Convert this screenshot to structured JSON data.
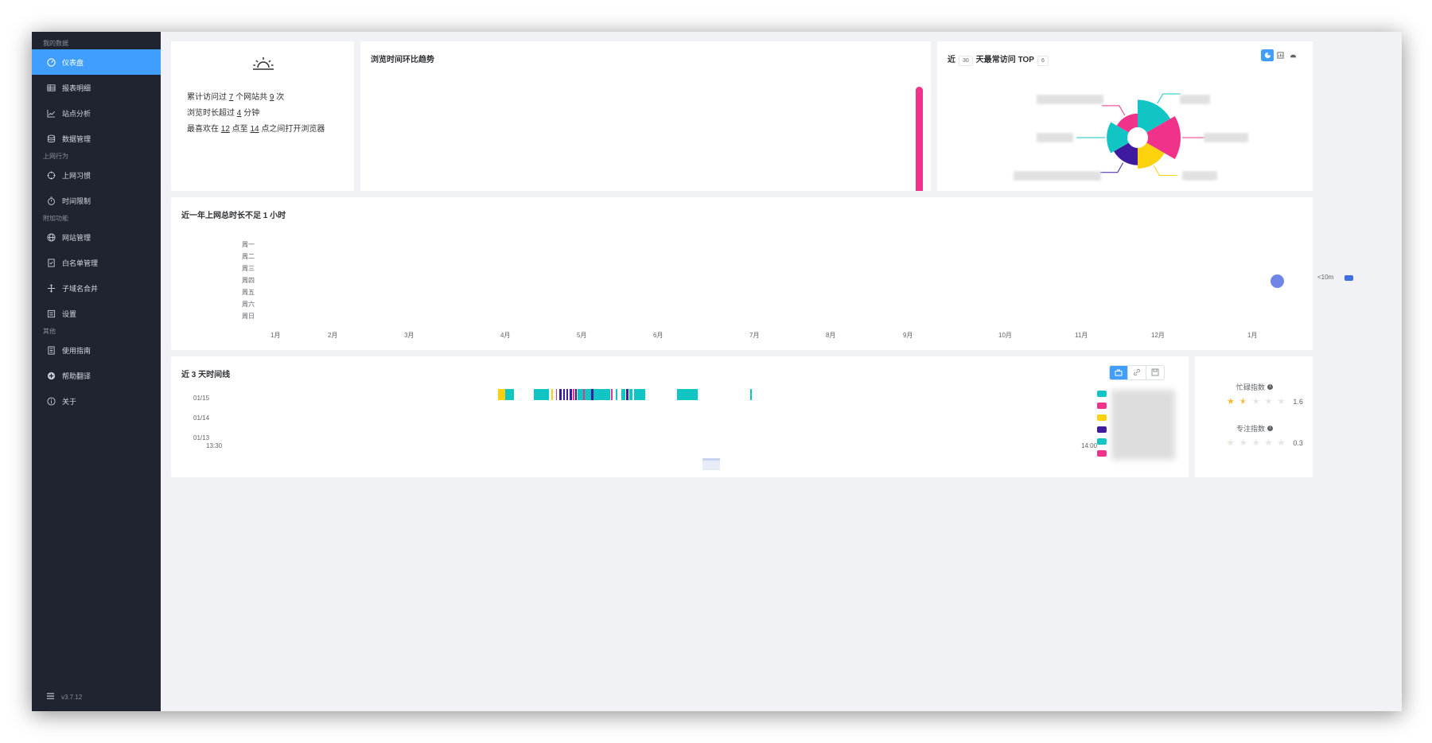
{
  "sidebar": {
    "groups": [
      {
        "title": "我的数据",
        "items": [
          {
            "label": "仪表盘",
            "icon": "dashboard-icon",
            "active": true
          },
          {
            "label": "报表明细",
            "icon": "table-icon"
          },
          {
            "label": "站点分析",
            "icon": "chart-line-icon"
          },
          {
            "label": "数据管理",
            "icon": "database-icon"
          }
        ]
      },
      {
        "title": "上网行为",
        "items": [
          {
            "label": "上网习惯",
            "icon": "target-icon"
          },
          {
            "label": "时间限制",
            "icon": "timer-icon"
          }
        ]
      },
      {
        "title": "附加功能",
        "items": [
          {
            "label": "网站管理",
            "icon": "globe-icon"
          },
          {
            "label": "白名单管理",
            "icon": "whitelist-icon"
          },
          {
            "label": "子域名合并",
            "icon": "merge-icon"
          },
          {
            "label": "设置",
            "icon": "settings-icon"
          }
        ]
      },
      {
        "title": "其他",
        "items": [
          {
            "label": "使用指南",
            "icon": "book-icon"
          },
          {
            "label": "帮助翻译",
            "icon": "translate-icon"
          },
          {
            "label": "关于",
            "icon": "info-icon"
          }
        ]
      }
    ],
    "version": "v3.7.12"
  },
  "summary": {
    "line1": {
      "prefix": "累计访问过 ",
      "sites": "7",
      "mid": " 个网站共 ",
      "visits": "9",
      "suffix": " 次"
    },
    "line2": {
      "prefix": "浏览时长超过 ",
      "minutes": "4",
      "suffix": " 分钟"
    },
    "line3": {
      "prefix": "最喜欢在 ",
      "from": "12",
      "mid": " 点至 ",
      "to": "14",
      "suffix": " 点之间打开浏览器"
    }
  },
  "trend": {
    "title": "浏览时间环比趋势"
  },
  "top": {
    "title_prefix": "近",
    "days": "30",
    "title_mid": "天最常访问 TOP",
    "count": "6"
  },
  "heatmap_card": {
    "title": "近一年上网总时长不足 1 小时",
    "weekdays": [
      "周一",
      "周二",
      "周三",
      "周四",
      "周五",
      "周六",
      "周日"
    ],
    "months": [
      "1月",
      "2月",
      "3月",
      "4月",
      "5月",
      "6月",
      "7月",
      "8月",
      "9月",
      "10月",
      "11月",
      "12月",
      "1月"
    ],
    "legend": "<10m"
  },
  "timeline": {
    "title": "近 3 天时间线",
    "dates": [
      "01/15",
      "01/14",
      "01/13"
    ],
    "start": "13:30",
    "end": "14:00"
  },
  "ratings": {
    "busy": {
      "title": "忙碌指数",
      "value": "1.6"
    },
    "focus": {
      "title": "专注指数",
      "value": "0.3"
    }
  },
  "colors": {
    "accent": "#409eff",
    "sidebar_bg": "#1f2430",
    "pink": "#f0328a",
    "teal": "#11c5c5",
    "yellow": "#fbd20b",
    "purple": "#3d1a9e"
  },
  "chart_data": [
    {
      "type": "pie",
      "title": "近 30 天最常访问 TOP 6",
      "categories": [
        "",
        "",
        "",
        "",
        "",
        ""
      ],
      "values": [
        0.16,
        0.19,
        0.12,
        0.1,
        0.12,
        0.08
      ],
      "colors": [
        "#11c5c5",
        "#f0328a",
        "#fbd20b",
        "#3d1a9e",
        "#11c5c5",
        "#f0328a"
      ]
    },
    {
      "type": "bar",
      "title": "浏览时间环比趋势",
      "series": [
        {
          "values": [
            1
          ]
        }
      ]
    },
    {
      "type": "heatmap",
      "title": "近一年上网总时长不足 1 小时",
      "ylabels": [
        "周一",
        "周二",
        "周三",
        "周四",
        "周五",
        "周六",
        "周日"
      ],
      "xlabels": [
        "1月",
        "2月",
        "3月",
        "4月",
        "5月",
        "6月",
        "7月",
        "8月",
        "9月",
        "10月",
        "11月",
        "12月",
        "1月"
      ],
      "legend": [
        "<10m"
      ]
    }
  ]
}
